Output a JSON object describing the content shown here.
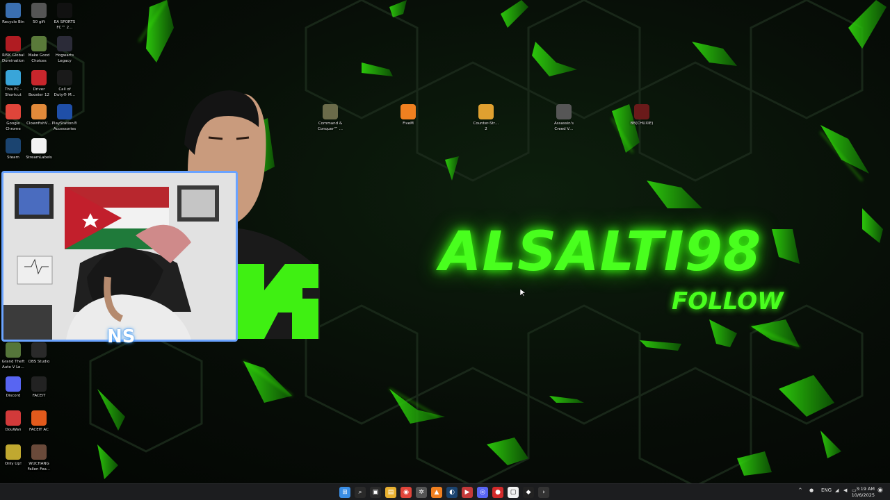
{
  "desktop": {
    "title_text": "ALSALTI98",
    "follow_text": "FOLLOW",
    "accent_color": "#49ff1e",
    "icons_left": [
      {
        "label": "Recycle Bin",
        "icon": "recycle-bin-icon"
      },
      {
        "label": "50 gift",
        "icon": "gift-app-icon"
      },
      {
        "label": "EA SPORTS\nFC™ 2…",
        "icon": "ea-sports-fc-icon"
      },
      {
        "label": "RISK Global\nDomination",
        "icon": "risk-icon"
      },
      {
        "label": "Make Good\nChoices",
        "icon": "make-good-choices-icon"
      },
      {
        "label": "Hogwarts\nLegacy",
        "icon": "hogwarts-legacy-icon"
      },
      {
        "label": "This PC -\nShortcut",
        "icon": "this-pc-icon"
      },
      {
        "label": "Driver\nBooster 12",
        "icon": "driver-booster-icon"
      },
      {
        "label": "Call of\nDuty® M…",
        "icon": "call-of-duty-icon"
      },
      {
        "label": "Google\nChrome",
        "icon": "chrome-icon"
      },
      {
        "label": "ClownfishV…",
        "icon": "clownfish-icon"
      },
      {
        "label": "PlayStation®\nAccessories",
        "icon": "playstation-accessories-icon"
      },
      {
        "label": "Steam",
        "icon": "steam-icon"
      },
      {
        "label": "StreamLabels",
        "icon": "streamlabels-icon"
      },
      {
        "label": "Grand Theft\nAuto V Le…",
        "icon": "gta-v-icon"
      },
      {
        "label": "OBS Studio",
        "icon": "obs-studio-icon"
      },
      {
        "label": "Discord",
        "icon": "discord-icon"
      },
      {
        "label": "FACEIT",
        "icon": "faceit-icon"
      },
      {
        "label": "DouWan",
        "icon": "douwan-icon"
      },
      {
        "label": "FACEIT AC",
        "icon": "faceit-ac-icon"
      },
      {
        "label": "Only Up!",
        "icon": "only-up-icon"
      },
      {
        "label": "WUCHANG\nFallen Fea…",
        "icon": "wuchang-icon"
      }
    ],
    "icons_top": [
      {
        "label": "Command &\nConquer™ …",
        "icon": "command-conquer-icon"
      },
      {
        "label": "FiveM",
        "icon": "fivem-icon"
      },
      {
        "label": "Counter-Str…\n2",
        "icon": "counter-strike-2-icon"
      },
      {
        "label": "Assassin's\nCreed V…",
        "icon": "assassins-creed-icon"
      },
      {
        "label": "ВВ(CHUXIE)",
        "icon": "chuxie-icon"
      }
    ]
  },
  "taskbar": {
    "apps": [
      "start-icon",
      "search-icon",
      "task-view-icon",
      "file-explorer-icon",
      "chrome-icon",
      "settings-icon",
      "fivem-icon",
      "steam-icon",
      "streaming-app-icon",
      "discord-icon",
      "red-app-icon",
      "streamlabels-icon",
      "faceit-icon",
      "terminal-icon"
    ],
    "language": "ENG",
    "time": "3:19 AM",
    "date": "10/6/2025"
  },
  "webcam": {
    "overlay_logo": "NS"
  }
}
